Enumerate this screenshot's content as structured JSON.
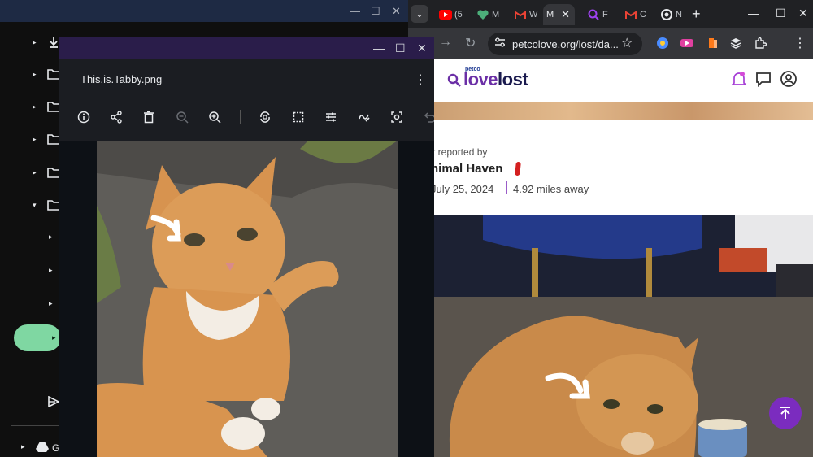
{
  "browser": {
    "tabs": [
      {
        "title": "(5",
        "icon": "youtube-icon",
        "color": "#ff0000"
      },
      {
        "title": "M",
        "icon": "heart-icon",
        "color": "#4caf7a"
      },
      {
        "title": "W",
        "icon": "gmail-icon",
        "color": "#ea4335"
      },
      {
        "title": "M",
        "icon": "gmail-icon",
        "color": "#ea4335",
        "active": true
      },
      {
        "title": "F",
        "icon": "search-icon",
        "color": "#a142f4"
      },
      {
        "title": "C",
        "icon": "gmail-icon",
        "color": "#ea4335"
      },
      {
        "title": "N",
        "icon": "chrome-icon",
        "color": "#e8eaed"
      }
    ],
    "url": "petcolove.org/lost/da..."
  },
  "site": {
    "logo_small": "petco",
    "logo_love": "love",
    "logo_lost": "lost",
    "reported_by": "t reported by",
    "reporter": "nimal Haven",
    "found_date": "July 25, 2024",
    "distance": "4.92 miles away"
  },
  "viewer": {
    "filename": "This.is.Tabby.png",
    "tools": [
      "info-icon",
      "share-icon",
      "delete-icon",
      "zoom-out-icon",
      "zoom-in-icon",
      "rotate-icon",
      "crop-icon",
      "adjust-icon",
      "markup-icon",
      "lens-icon",
      "undo-icon"
    ]
  },
  "files": {
    "bottom_label": "G"
  },
  "colors": {
    "accent_purple": "#7b2cbf",
    "pill_green": "#7fd7a2"
  }
}
